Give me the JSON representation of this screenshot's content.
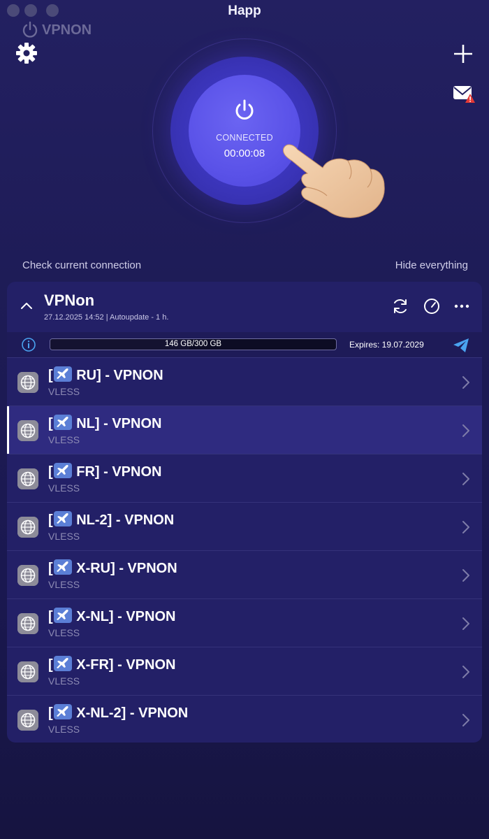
{
  "app": {
    "title": "Happ",
    "brand": "VPNON"
  },
  "connection": {
    "status": "CONNECTED",
    "timer": "00:00:08"
  },
  "links": {
    "check": "Check current connection",
    "hide": "Hide everything"
  },
  "subscription": {
    "name": "VPNon",
    "meta": "27.12.2025 14:52 | Autoupdate - 1 h.",
    "usage_text": "146 GB/300 GB",
    "usage_fraction": 0.487,
    "expires": "Expires: 19.07.2029"
  },
  "servers": [
    {
      "pre": "[",
      "post": " RU] - VPNON",
      "proto": "VLESS"
    },
    {
      "pre": "[",
      "post": " NL] - VPNON",
      "proto": "VLESS"
    },
    {
      "pre": "[",
      "post": " FR] - VPNON",
      "proto": "VLESS"
    },
    {
      "pre": "[",
      "post": " NL-2] - VPNON",
      "proto": "VLESS"
    },
    {
      "pre": "[",
      "post": " X-RU] - VPNON",
      "proto": "VLESS"
    },
    {
      "pre": "[",
      "post": " X-NL] - VPNON",
      "proto": "VLESS"
    },
    {
      "pre": "[",
      "post": " X-FR] - VPNON",
      "proto": "VLESS"
    },
    {
      "pre": "[",
      "post": " X-NL-2] - VPNON",
      "proto": "VLESS"
    }
  ],
  "selected_server_index": 1,
  "icons": {
    "settings": "gear-icon",
    "add": "plus-icon",
    "mail": "mail-alert-icon",
    "power": "power-icon",
    "refresh": "refresh-icon",
    "speed": "speedometer-icon",
    "more": "more-icon",
    "info": "info-icon",
    "telegram": "send-icon",
    "server": "globe-icon",
    "flag": "airplane-icon",
    "chevron": "chevron-right-icon"
  },
  "colors": {
    "accent": "#5a52e8",
    "background": "#1d1b55",
    "panel": "#232067",
    "selected": "#2f2b80",
    "telegram": "#4aa3f0"
  }
}
